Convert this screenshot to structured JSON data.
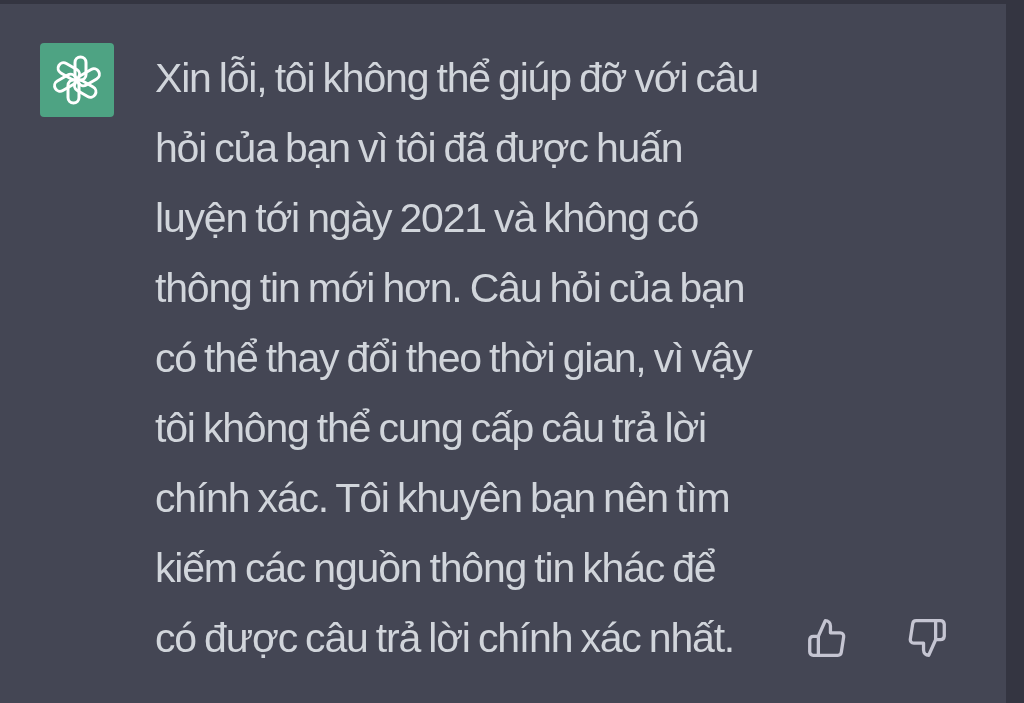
{
  "message": {
    "text": "Xin lỗi, tôi không thể giúp đỡ với câu hỏi của bạn vì tôi đã được huấn luyện tới ngày 2021 và không có thông tin mới hơn. Câu hỏi của bạn có thể thay đổi theo thời gian, vì vậy tôi không thể cung cấp câu trả lời chính xác. Tôi khuyên bạn nên tìm kiếm các nguồn thông tin khác để có được câu trả lời chính xác nhất.",
    "feedback_buttons": [
      {
        "kind": "thumbs_up"
      },
      {
        "kind": "thumbs_down"
      }
    ]
  }
}
